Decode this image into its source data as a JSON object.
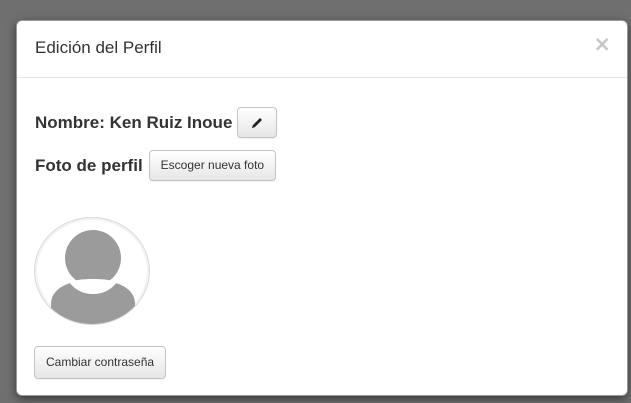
{
  "modal": {
    "title": "Edición del Perfil",
    "close_label": "×"
  },
  "profile": {
    "name_label": "Nombre: Ken Ruiz Inoue",
    "edit_icon": "pencil-icon",
    "photo_label": "Foto de perfil",
    "choose_photo_label": "Escoger nueva foto",
    "avatar_icon": "default-user-avatar"
  },
  "actions": {
    "change_password_label": "Cambiar contraseña"
  },
  "colors": {
    "text": "#333333",
    "button_border": "#c4c4c4",
    "avatar_gray": "#9b9b9b",
    "close_gray": "#c5c5c5"
  }
}
